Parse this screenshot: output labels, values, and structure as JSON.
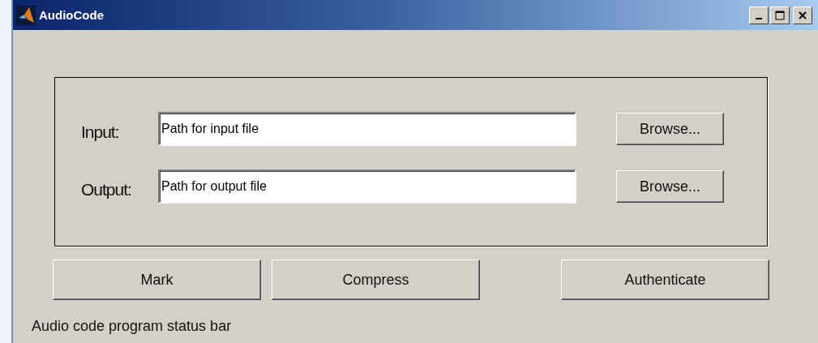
{
  "window": {
    "title": "AudioCode"
  },
  "fields": [
    {
      "label": "Input:",
      "placeholder": "Path for input file",
      "button": "Browse..."
    },
    {
      "label": "Output:",
      "placeholder": "Path for output file",
      "button": "Browse..."
    }
  ],
  "actions": [
    "Mark",
    "Compress",
    "Authenticate"
  ],
  "status_bar": "Audio code program status bar"
}
